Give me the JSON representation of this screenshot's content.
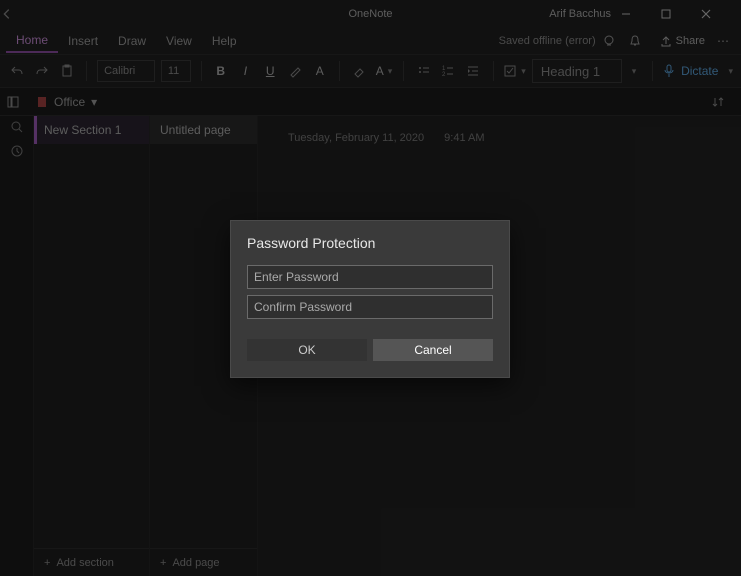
{
  "titlebar": {
    "app_title": "OneNote",
    "user_name": "Arif Bacchus"
  },
  "menu": {
    "tabs": [
      "Home",
      "Insert",
      "Draw",
      "View",
      "Help"
    ],
    "active_index": 0,
    "status_text": "Saved offline (error)",
    "share_label": "Share"
  },
  "ribbon": {
    "font_name": "Calibri",
    "font_size": "11",
    "style_label": "Heading 1",
    "dictate_label": "Dictate"
  },
  "navbar": {
    "notebook_label": "Office"
  },
  "sections": {
    "items": [
      "New Section 1"
    ],
    "add_label": "Add section"
  },
  "pages": {
    "items": [
      "Untitled page"
    ],
    "add_label": "Add page"
  },
  "canvas": {
    "date_text": "Tuesday, February 11, 2020",
    "time_text": "9:41 AM"
  },
  "dialog": {
    "title": "Password Protection",
    "enter_placeholder": "Enter Password",
    "confirm_placeholder": "Confirm Password",
    "ok_label": "OK",
    "cancel_label": "Cancel"
  }
}
